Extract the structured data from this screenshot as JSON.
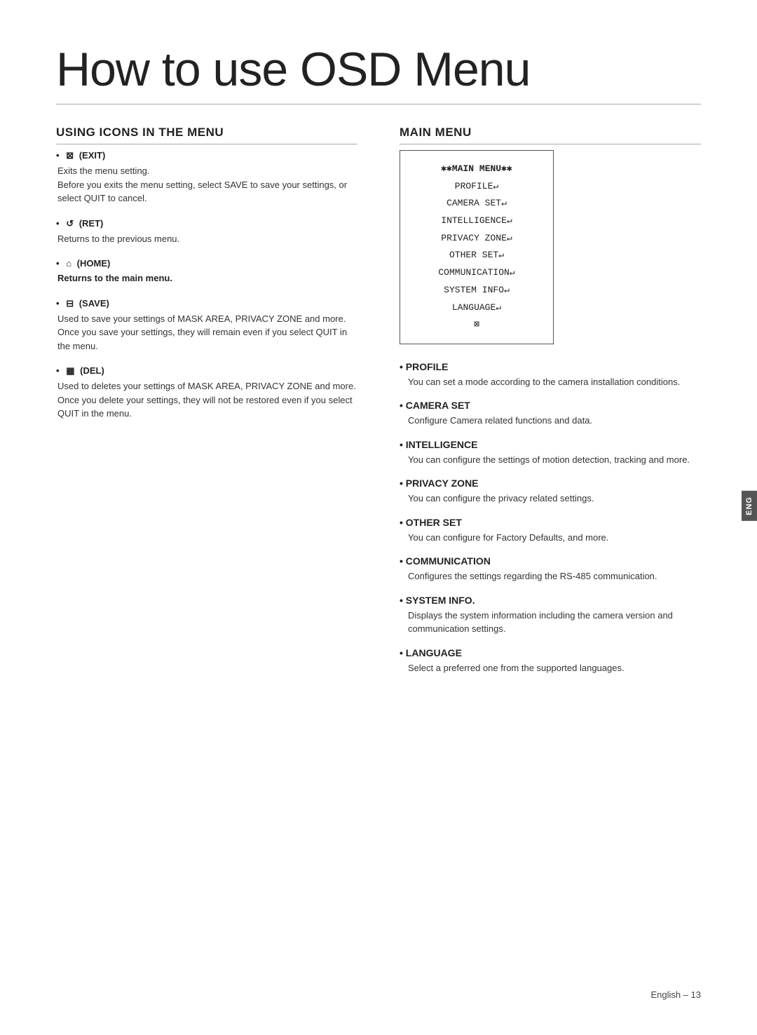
{
  "page": {
    "title": "How to use OSD Menu",
    "footer": "English – 13"
  },
  "left_section": {
    "heading": "USING ICONS IN THE MENU",
    "items": [
      {
        "symbol": "⊠",
        "label": "(EXIT)",
        "lines": [
          "Exits the menu setting.",
          "Before you exits the menu setting, select SAVE to save your settings, or select QUIT to cancel."
        ]
      },
      {
        "symbol": "↺",
        "label": "(RET)",
        "lines": [
          "Returns to the previous menu."
        ]
      },
      {
        "symbol": "⌂",
        "label": "(HOME)",
        "lines": []
      },
      {
        "symbol": "⊟",
        "label": "(SAVE)",
        "lines": [
          "Used to save your settings of MASK AREA, PRIVACY ZONE and more.",
          "Once you save your settings, they will remain even if you select QUIT in the menu."
        ]
      },
      {
        "symbol": "⊞",
        "label": "(DEL)",
        "lines": [
          "Used to deletes your settings of MASK AREA, PRIVACY ZONE and more.",
          "Once you delete your settings, they will not be restored even if you select QUIT in the menu."
        ]
      }
    ]
  },
  "right_section": {
    "heading": "MAIN MENU",
    "osd_menu": {
      "title": "✱✱MAIN MENU✱✱",
      "items": [
        "PROFILE↵",
        "CAMERA SET↵",
        "INTELLIGENCE↵",
        "PRIVACY ZONE↵",
        "OTHER SET↵",
        "COMMUNICATION↵",
        "SYSTEM INFO↵",
        "LANGUAGE↵"
      ],
      "exit_symbol": "⊠"
    },
    "menu_items": [
      {
        "title": "PROFILE",
        "desc": "You can set a mode according to the camera installation conditions."
      },
      {
        "title": "CAMERA SET",
        "desc": "Configure Camera related functions and data."
      },
      {
        "title": "INTELLIGENCE",
        "desc": "You can configure the settings of motion detection, tracking and more."
      },
      {
        "title": "PRIVACY ZONE",
        "desc": "You can configure the privacy related settings."
      },
      {
        "title": "OTHER SET",
        "desc": "You can configure for Factory Defaults, and more."
      },
      {
        "title": "COMMUNICATION",
        "desc": "Configures the settings regarding the RS-485 communication."
      },
      {
        "title": "SYSTEM INFO.",
        "desc": "Displays the system information including the camera version and communication settings."
      },
      {
        "title": "LANGUAGE",
        "desc": "Select a preferred one from the supported languages."
      }
    ]
  },
  "eng_tab": "ENG",
  "home_bold_text": "Returns to the main menu."
}
